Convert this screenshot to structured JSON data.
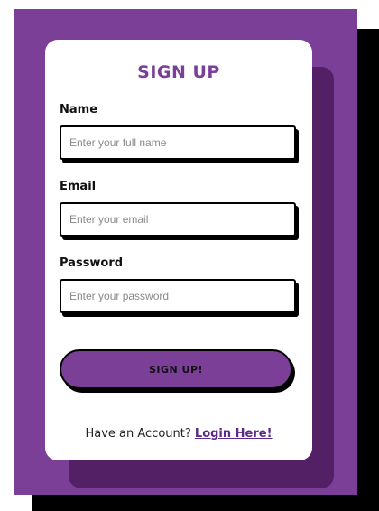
{
  "colors": {
    "accent": "#7b3f98",
    "accent_dark": "#532065",
    "link": "#5b2a86",
    "shadow": "#000000",
    "card": "#ffffff"
  },
  "form": {
    "title": "SIGN UP",
    "name": {
      "label": "Name",
      "value": "",
      "placeholder": "Enter your full name"
    },
    "email": {
      "label": "Email",
      "value": "",
      "placeholder": "Enter your email"
    },
    "password": {
      "label": "Password",
      "value": "",
      "placeholder": "Enter your password"
    },
    "submit_label": "SIGN UP!"
  },
  "footer": {
    "prompt": "Have an Account?",
    "link_label": "Login Here!"
  }
}
